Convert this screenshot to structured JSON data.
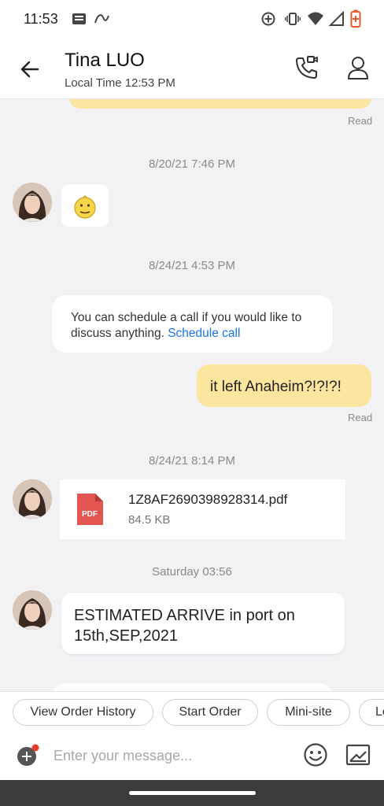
{
  "status_bar": {
    "time": "11:53",
    "icons": [
      "notification-icon",
      "app-notification-icon",
      "data-saver-icon",
      "vibrate-icon",
      "wifi-icon",
      "signal-icon",
      "battery-low-icon"
    ],
    "battery_color": "#e8592a"
  },
  "header": {
    "contact_name": "Tina LUO",
    "local_time": "Local Time 12:53 PM",
    "icons": [
      "back-arrow-icon",
      "video-call-icon",
      "profile-icon"
    ]
  },
  "chat": {
    "colors": {
      "outgoing_bubble": "#fbe6a0",
      "incoming_bubble": "#ffffff",
      "link": "#1a73e8",
      "background": "#f2f2f5"
    },
    "read_label_top": "Read",
    "groups": [
      {
        "timestamp": "8/20/21 7:46 PM",
        "message": {
          "type": "emoji",
          "icon": "smiley-emoji-icon"
        }
      },
      {
        "timestamp": "8/24/21 4:53 PM",
        "system": {
          "text": "You can schedule a call if you would like to discuss anything. ",
          "link": "Schedule call"
        },
        "outgoing": {
          "text": "it left Anaheim?!?!?!",
          "status": "Read"
        }
      },
      {
        "timestamp": "8/24/21 8:14 PM",
        "file": {
          "name": "1Z8AF2690398928314.pdf",
          "size": "84.5 KB",
          "icon_label": "PDF"
        }
      },
      {
        "timestamp": "Saturday 03:56",
        "message": {
          "type": "text",
          "text": "ESTIMATED ARRIVE in port on 15th,SEP,2021"
        }
      }
    ]
  },
  "quick_actions": [
    "View Order History",
    "Start Order",
    "Mini-site",
    "Le"
  ],
  "composer": {
    "placeholder": "Enter your message...",
    "value": ""
  }
}
